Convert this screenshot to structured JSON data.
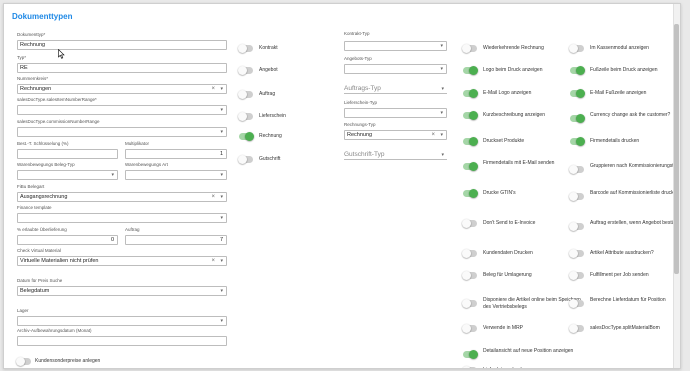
{
  "dialog": {
    "title": "Dokumenttypen"
  },
  "left": {
    "dokumenttyp": {
      "label": "Dokumenttyp*",
      "value": "Rechnung"
    },
    "typ": {
      "label": "Typ*",
      "value": "RE"
    },
    "nummernkreis": {
      "label": "Nummernkreis*",
      "value": "Rechnungen"
    },
    "sales_item_number_range": {
      "label": "salesDocType.salesItemNumberRange*",
      "value": ""
    },
    "commission_number_range": {
      "label": "salesDocType.commissionNumberRange",
      "value": ""
    },
    "best_schluesselung": {
      "label": "Best.-T. Schlüsselung (%)",
      "value": ""
    },
    "multiplikator": {
      "label": "Multiplikator",
      "value": "1"
    },
    "warenbewegung_beleg_typ": {
      "label": "Warenbewegungs Beleg-Typ",
      "value": ""
    },
    "warenbewegung_art": {
      "label": "Warenbewegungs Art",
      "value": ""
    },
    "fibu_belegart": {
      "label": "FiBu Belegart",
      "value": "Ausgangsrechnung"
    },
    "finance_template": {
      "label": "Finance template",
      "value": ""
    },
    "erlaubte_ueberlieferung": {
      "label": "% erlaubte Überlieferung",
      "value": "0"
    },
    "auftrag": {
      "label": "Auftrag",
      "value": "7"
    },
    "check_virtual_material": {
      "label": "Check Virtual Material",
      "value": "Virtuelle Materialien nicht prüfen"
    },
    "datum_preis_suche": {
      "label": "Datum für Preis Suche",
      "value": "Belegdatum"
    },
    "lager": {
      "label": "Lager",
      "value": ""
    },
    "archiv_aufbewahrungsdatum": {
      "label": "Archiv-Aufbewahrungsdatum (Monat)",
      "value": ""
    },
    "kundensonderpreise": {
      "label": "Kundensonderpreise anlegen",
      "on": false
    }
  },
  "toggles_col2": [
    {
      "label": "Kontrakt",
      "on": false
    },
    {
      "label": "Angebot",
      "on": false
    },
    {
      "label": "Auftrag",
      "on": false
    },
    {
      "label": "Lieferschein",
      "on": false
    },
    {
      "label": "Rechnung",
      "on": true
    },
    {
      "label": "Gutschrift",
      "on": false
    }
  ],
  "col3": {
    "kontrakt_typ": {
      "label": "Kontrakt-Typ",
      "value": ""
    },
    "angebots_typ": {
      "label": "Angebots-Typ",
      "value": ""
    },
    "auftrags_typ": {
      "placeholder": "Auftrags-Typ"
    },
    "lieferschein_typ": {
      "label": "Lieferschein-Typ",
      "value": ""
    },
    "rechnungs_typ": {
      "label": "Rechnungs-Typ",
      "value": "Rechnung"
    },
    "gutschrift_typ": {
      "placeholder": "Gutschrift-Typ"
    }
  },
  "toggles_col4": [
    {
      "label": "Wiederkehrende Rechnung",
      "on": false
    },
    {
      "label": "Logo beim Druck anzeigen",
      "on": true
    },
    {
      "label": "E-Mail Logo anzeigen",
      "on": true
    },
    {
      "label": "Kurzbeschreibung anzeigen",
      "on": true
    },
    {
      "label": "Druckset Produkte",
      "on": true
    },
    {
      "label": "Firmendetails mit E-Mail senden",
      "on": true
    },
    {
      "label": "Drucke GTIN's",
      "on": true
    },
    {
      "label": "Don't Send to E-Invoice",
      "on": false
    },
    {
      "label": "Kundendaten Drucken",
      "on": false
    },
    {
      "label": "Beleg für Umlagerung",
      "on": false
    },
    {
      "label": "Disponiere die Artikel online beim Speichern des Vertriebsbelegs",
      "on": false
    },
    {
      "label": "Verwende in MRP",
      "on": false
    },
    {
      "label": "Detailansicht auf neue Position anzeigen",
      "on": true
    },
    {
      "label": "Lieferdatum drucken",
      "on": false
    }
  ],
  "toggles_col5": [
    {
      "label": "Im Kassenmodul anzeigen",
      "on": false
    },
    {
      "label": "Fußzeile beim Druck anzeigen",
      "on": true
    },
    {
      "label": "E-Mail Fußzeile anzeigen",
      "on": true
    },
    {
      "label": "Currency change ask the customer?",
      "on": true
    },
    {
      "label": "Firmendetails drucken",
      "on": true
    },
    {
      "label": "Gruppieren nach Kommissionierungstext",
      "on": false
    },
    {
      "label": "Barcode auf Kommissionierliste drucken",
      "on": false
    },
    {
      "label": "Auftrag erstellen, wenn Angebot bestätigt ist",
      "on": false
    },
    {
      "label": "Artikel Attribute ausdrucken?",
      "on": false
    },
    {
      "label": "Fulfillment per Job senden",
      "on": false
    },
    {
      "label": "Berechne Lieferdatum für Position",
      "on": false
    },
    {
      "label": "salesDocType.splitMaterialBom",
      "on": false
    }
  ]
}
